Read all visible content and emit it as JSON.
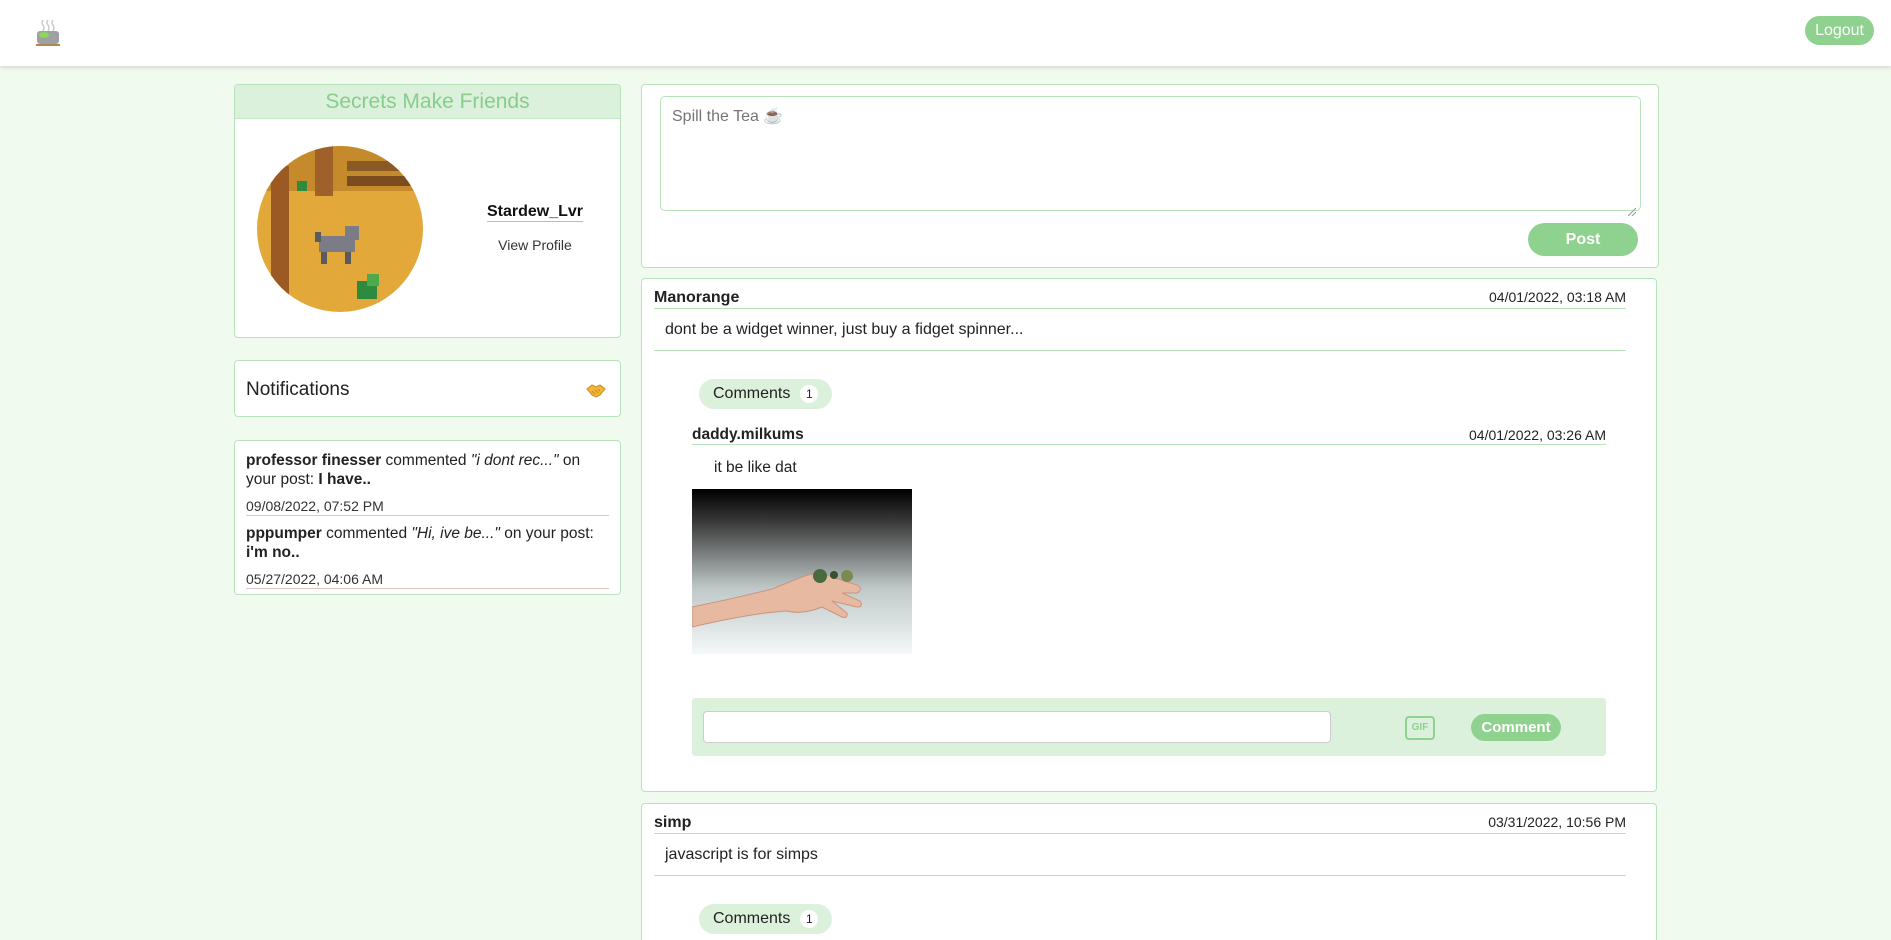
{
  "nav": {
    "logo_icon": "teapot-icon",
    "logout_label": "Logout"
  },
  "colors": {
    "accent": "#8fd18f",
    "accent_light": "#dcf1dc",
    "background": "#f1faee",
    "border": "#b8e2bb"
  },
  "profile": {
    "header": "Secrets Make Friends",
    "username": "Stardew_Lvr",
    "view_profile": "View Profile"
  },
  "notifications": {
    "title": "Notifications",
    "icon": "handshake-icon",
    "items": [
      {
        "user": "professor finesser",
        "action": " commented ",
        "snippet": "\"i dont rec...\"",
        "on_post": " on your post: ",
        "post_title": "I have..",
        "time": "09/08/2022, 07:52 PM"
      },
      {
        "user": "pppumper",
        "action": " commented ",
        "snippet": "\"Hi, ive be...\"",
        "on_post": " on your post: ",
        "post_title": "i'm no..",
        "time": "05/27/2022, 04:06 AM"
      }
    ]
  },
  "compose": {
    "placeholder": "Spill the Tea ☕",
    "post_label": "Post"
  },
  "posts": [
    {
      "author": "Manorange",
      "date": "04/01/2022, 03:18 AM",
      "body": "dont be a widget winner, just buy a fidget spinner...",
      "comments_label": "Comments",
      "comments_count": "1",
      "comment": {
        "author": "daddy.milkums",
        "date": "04/01/2022, 03:26 AM",
        "text": "it be like dat"
      },
      "gif_label": "GIF",
      "comment_btn": "Comment"
    },
    {
      "author": "simp",
      "date": "03/31/2022, 10:56 PM",
      "body": "javascript is for simps",
      "comments_label": "Comments",
      "comments_count": "1"
    }
  ]
}
